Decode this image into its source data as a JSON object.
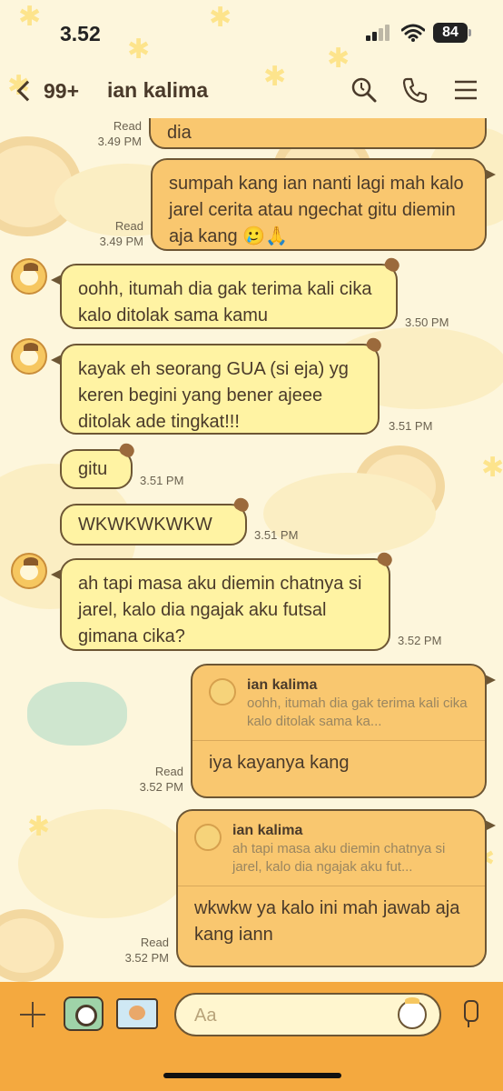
{
  "status_bar": {
    "time": "3.52",
    "battery": "84"
  },
  "header": {
    "back_count": "99+",
    "title": "ian kalima",
    "icons": [
      "back-chevron-icon",
      "search-icon",
      "phone-icon",
      "menu-icon"
    ]
  },
  "messages": [
    {
      "direction": "out",
      "text": "dia",
      "status": "Read",
      "time": "3.49 PM"
    },
    {
      "direction": "out",
      "text": "sumpah kang ian nanti lagi mah kalo jarel cerita atau ngechat gitu diemin aja kang 🥲🙏",
      "status": "Read",
      "time": "3.49 PM"
    },
    {
      "direction": "in",
      "text": "oohh, itumah dia gak terima kali cika kalo ditolak sama kamu",
      "time": "3.50 PM"
    },
    {
      "direction": "in",
      "text": "kayak eh seorang GUA (si eja) yg keren begini yang bener ajeee ditolak ade tingkat!!!",
      "time": "3.51 PM"
    },
    {
      "direction": "in",
      "text": "gitu",
      "time": "3.51 PM"
    },
    {
      "direction": "in",
      "text": "WKWKWKWKW",
      "time": "3.51 PM"
    },
    {
      "direction": "in",
      "text": "ah tapi masa aku diemin chatnya si jarel, kalo dia ngajak aku futsal gimana cika?",
      "time": "3.52 PM"
    },
    {
      "direction": "out",
      "reply_to": {
        "name": "ian kalima",
        "text": "oohh, itumah dia gak terima kali cika kalo ditolak sama ka..."
      },
      "text": "iya kayanya kang",
      "status": "Read",
      "time": "3.52 PM"
    },
    {
      "direction": "out",
      "reply_to": {
        "name": "ian kalima",
        "text": "ah tapi masa aku diemin chatnya si jarel, kalo dia ngajak aku fut..."
      },
      "text": "wkwkw ya kalo ini mah jawab aja kang iann",
      "status": "Read",
      "time": "3.52 PM"
    }
  ],
  "input_bar": {
    "placeholder": "Aa",
    "icons": [
      "plus-icon",
      "camera-icon",
      "photo-icon",
      "sticker-icon",
      "microphone-icon"
    ]
  },
  "colors": {
    "background": "#fdf6dc",
    "incoming_bubble": "#fff3a3",
    "outgoing_bubble": "#f9c76f",
    "bubble_border": "#6d5634",
    "input_bar": "#f4a93f"
  }
}
